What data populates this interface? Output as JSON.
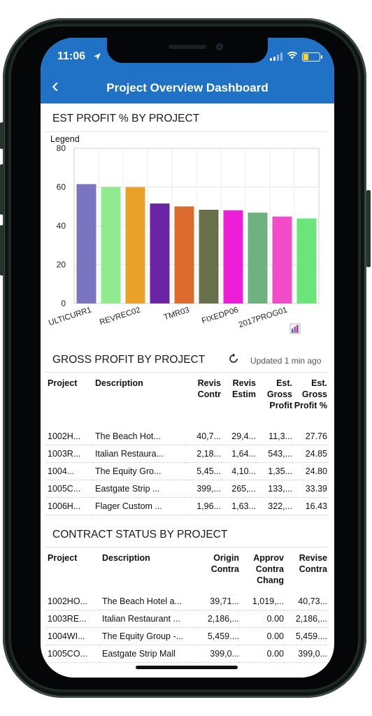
{
  "status": {
    "time": "11:06"
  },
  "nav": {
    "title": "Project Overview Dashboard",
    "back_glyph": "‹"
  },
  "est_profit": {
    "title": "EST PROFIT % BY PROJECT",
    "legend_label": "Legend",
    "chart_data": {
      "type": "bar",
      "categories": [
        "ULTICURR1",
        "",
        "REVREC02",
        "",
        "TMR03",
        "",
        "FIXEDP06",
        "",
        "2017PROG01",
        ""
      ],
      "values": [
        61.5,
        60,
        60,
        51.5,
        50,
        48.3,
        48,
        46.8,
        44.8,
        43.8
      ],
      "colors": [
        "#7b75c1",
        "#90ea8e",
        "#e9a227",
        "#6b24a6",
        "#dc6b2d",
        "#6a6f4b",
        "#ee1ed8",
        "#6fb27f",
        "#f24cc8",
        "#6be57a"
      ],
      "ylim": [
        0,
        80
      ],
      "yticks": [
        0,
        20,
        40,
        60,
        80
      ],
      "grid": true
    },
    "chart_icon": "bar-chart-icon"
  },
  "gross_profit": {
    "title": "GROSS PROFIT BY PROJECT",
    "updated": "Updated 1 min ago",
    "columns": [
      "Project",
      "Description",
      "Revis Contr",
      "Revis Estim",
      "Est. Gross Profit",
      "Est. Gross Profit %"
    ],
    "rows": [
      [
        "1002H...",
        "The Beach Hot...",
        "40,7...",
        "29,4...",
        "11,3...",
        "27.76"
      ],
      [
        "1003R...",
        "Italian Restaura...",
        "2,18...",
        "1,64...",
        "543,...",
        "24.85"
      ],
      [
        "1004...",
        "The Equity Gro...",
        "5,45...",
        "4,10...",
        "1,35...",
        "24.80"
      ],
      [
        "1005C...",
        "Eastgate Strip ...",
        "399,...",
        "265,...",
        "133,...",
        "33.39"
      ],
      [
        "1006H...",
        "Flager Custom ...",
        "1,96...",
        "1,63...",
        "322,...",
        "16.43"
      ]
    ]
  },
  "contract_status": {
    "title": "CONTRACT STATUS BY PROJECT",
    "columns": [
      "Project",
      "Description",
      "Origin Contra",
      "Approv Contra Chang",
      "Revise Contra"
    ],
    "rows": [
      [
        "1002HO...",
        "The Beach Hotel a...",
        "39,71...",
        "1,019,...",
        "40,73..."
      ],
      [
        "1003RE...",
        "Italian Restaurant ...",
        "2,186,...",
        "0.00",
        "2,186,..."
      ],
      [
        "1004WI...",
        "The Equity Group -...",
        "5,459....",
        "0.00",
        "5,459...."
      ],
      [
        "1005CO...",
        "Eastgate Strip Mall",
        "399,0...",
        "0.00",
        "399,0..."
      ]
    ]
  }
}
